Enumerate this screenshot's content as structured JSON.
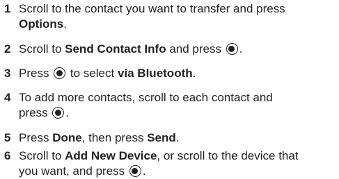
{
  "steps": [
    {
      "number": "1",
      "line1_a": "Scroll to the contact you want to transfer and press",
      "line2_bold": "Options",
      "line2_tail": "."
    },
    {
      "number": "2",
      "pre": "Scroll to ",
      "bold": "Send Contact Info",
      "mid": " and press ",
      "tail": "."
    },
    {
      "number": "3",
      "pre": "Press ",
      "mid": " to select ",
      "bold": "via Bluetooth",
      "tail": "."
    },
    {
      "number": "4",
      "line1": "To add more contacts, scroll to each contact and",
      "line2_pre": "press ",
      "tail": "."
    },
    {
      "number": "5",
      "pre": "Press ",
      "bold1": "Done",
      "mid": ", then press ",
      "bold2": "Send",
      "tail": "."
    },
    {
      "number": "6",
      "line1_pre": "Scroll to ",
      "line1_bold": "Add New Device",
      "line1_tail": ", or scroll to the device that",
      "line2_pre": "you want, and press ",
      "tail": "."
    }
  ],
  "icons": {
    "nav_key": "center-select-key-icon"
  }
}
